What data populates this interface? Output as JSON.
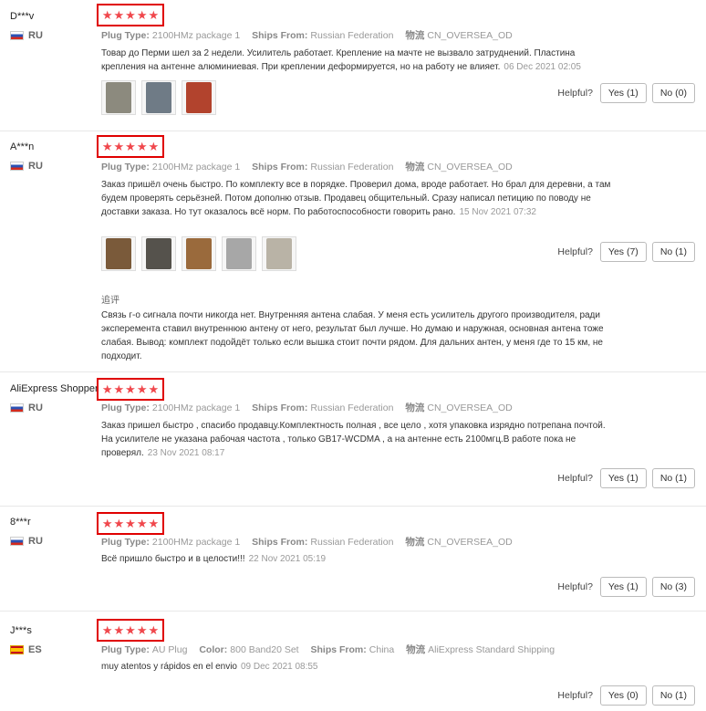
{
  "ui": {
    "helpful_label": "Helpful?",
    "star_glyph": "★",
    "star_color": "#f0474c",
    "highlight_box_color": "#e00000"
  },
  "reviews": [
    {
      "user": "D***v",
      "country": "RU",
      "flag": "flag-ru",
      "rating": 5,
      "meta": [
        {
          "label": "Plug Type:",
          "value": "2100HMz package 1"
        },
        {
          "label": "Ships From:",
          "value": "Russian Federation"
        },
        {
          "label": "物流",
          "value": "CN_OVERSEA_OD"
        }
      ],
      "text": "Товар до Перми шел за 2 недели. Усилитель работает. Крепление на мачте не вызвало затруднений. Пластина крепления на антенне алюминиевая. При креплении деформируется, но на работу не влияет.",
      "date": "06 Dec 2021 02:05",
      "photos": [
        {
          "name": "review-photo-1",
          "color": "#8c8a7e"
        },
        {
          "name": "review-photo-2",
          "color": "#6f7b86"
        },
        {
          "name": "review-photo-3",
          "color": "#b2432d"
        }
      ],
      "yes": "Yes (1)",
      "no": "No (0)"
    },
    {
      "user": "A***n",
      "country": "RU",
      "flag": "flag-ru",
      "rating": 5,
      "meta": [
        {
          "label": "Plug Type:",
          "value": "2100HMz package 1"
        },
        {
          "label": "Ships From:",
          "value": "Russian Federation"
        },
        {
          "label": "物流",
          "value": "CN_OVERSEA_OD"
        }
      ],
      "text": "Заказ пришёл очень быстро. По комплекту все в порядке. Проверил дома, вроде работает. Но брал для деревни, а там будем проверять серьёзней. Потом дополню отзыв. Продавец общительный. Сразу написал петицию по поводу не доставки заказа. Но тут оказалось всё норм. По работоспособности говорить рано.",
      "date": "15 Nov 2021 07:32",
      "photos": [
        {
          "name": "review-photo-1",
          "color": "#7a5a3a"
        },
        {
          "name": "review-photo-2",
          "color": "#55524c"
        },
        {
          "name": "review-photo-3",
          "color": "#9a6a3c"
        },
        {
          "name": "review-photo-4",
          "color": "#a7a7a7"
        },
        {
          "name": "review-photo-5",
          "color": "#b9b3a6"
        }
      ],
      "yes": "Yes (7)",
      "no": "No (1)",
      "follow_up_label": "追评",
      "follow_up": "Связь г-о сигнала почти никогда нет. Внутренняя антена слабая. У меня есть усилитель другого производителя, ради эксперемента ставил внутреннюю антену от него, результат был лучше. Но думаю и наружная, основная антена тоже слабая. Вывод: комплект подойдёт только если вышка стоит почти рядом. Для дальних антен, у меня где то 15 км, не подходит."
    },
    {
      "user": "AliExpress Shopper",
      "country": "RU",
      "flag": "flag-ru",
      "rating": 5,
      "meta": [
        {
          "label": "Plug Type:",
          "value": "2100HMz package 1"
        },
        {
          "label": "Ships From:",
          "value": "Russian Federation"
        },
        {
          "label": "物流",
          "value": "CN_OVERSEA_OD"
        }
      ],
      "text": "Заказ пришел быстро , спасибо продавцу.Комплектность полная , все цело , хотя упаковка изрядно потрепана почтой. На усилителе не указана рабочая частота , только GB17-WCDMA , а на антенне есть 2100мгц.В работе пока не проверял.",
      "date": "23 Nov 2021 08:17",
      "photos": [],
      "yes": "Yes (1)",
      "no": "No (1)"
    },
    {
      "user": "8***r",
      "country": "RU",
      "flag": "flag-ru",
      "rating": 5,
      "meta": [
        {
          "label": "Plug Type:",
          "value": "2100HMz package 1"
        },
        {
          "label": "Ships From:",
          "value": "Russian Federation"
        },
        {
          "label": "物流",
          "value": "CN_OVERSEA_OD"
        }
      ],
      "text": "Всё пришло быстро и в целости!!!",
      "date": "22 Nov 2021 05:19",
      "photos": [],
      "yes": "Yes (1)",
      "no": "No (3)"
    },
    {
      "user": "J***s",
      "country": "ES",
      "flag": "flag-es",
      "rating": 5,
      "meta": [
        {
          "label": "Plug Type:",
          "value": "AU Plug"
        },
        {
          "label": "Color:",
          "value": "800 Band20 Set"
        },
        {
          "label": "Ships From:",
          "value": "China"
        },
        {
          "label": "物流",
          "value": "AliExpress Standard Shipping"
        }
      ],
      "text": "muy atentos y rápidos en el envio",
      "date": "09 Dec 2021 08:55",
      "photos": [],
      "yes": "Yes (0)",
      "no": "No (1)"
    }
  ]
}
